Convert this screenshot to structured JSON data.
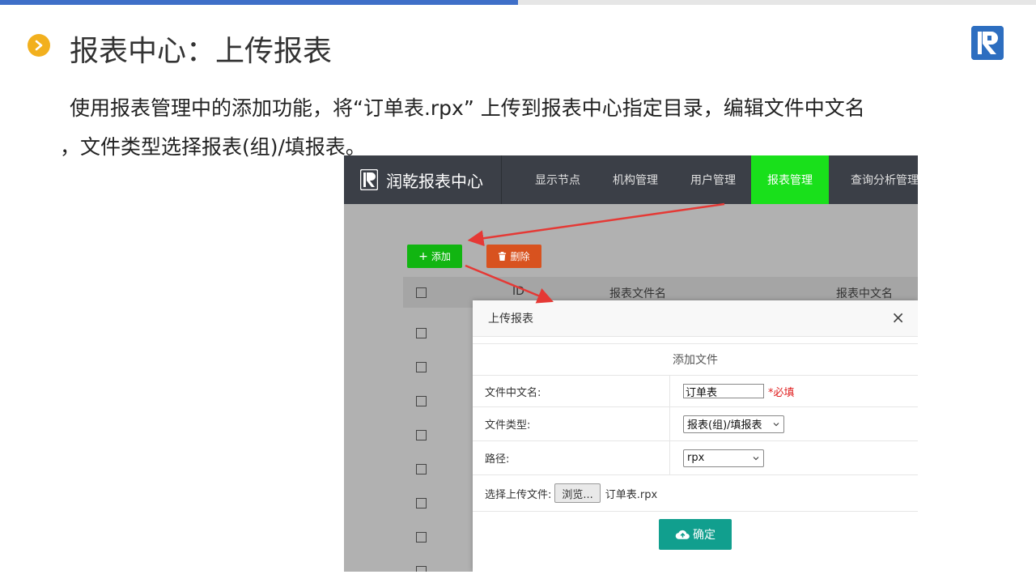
{
  "slide": {
    "title": "报表中心：上传报表",
    "description_line1": "使用报表管理中的添加功能，将“订单表.rpx” 上传到报表中心指定目录，编辑文件中文名",
    "description_line2": "，文件类型选择报表(组)/填报表。"
  },
  "app": {
    "brand": "润乾报表中心",
    "nav": [
      {
        "label": "显示节点",
        "active": false
      },
      {
        "label": "机构管理",
        "active": false
      },
      {
        "label": "用户管理",
        "active": false
      },
      {
        "label": "报表管理",
        "active": true
      },
      {
        "label": "查询分析管理",
        "active": false
      }
    ],
    "toolbar": {
      "add_label": "添加",
      "delete_label": "删除"
    },
    "table": {
      "columns": [
        "ID",
        "报表文件名",
        "报表中文名"
      ],
      "row_count": 9
    }
  },
  "modal": {
    "title": "上传报表",
    "close_symbol": "×",
    "section_header": "添加文件",
    "fields": {
      "chinese_name_label": "文件中文名:",
      "chinese_name_value": "订单表",
      "required_text": "*必填",
      "file_type_label": "文件类型:",
      "file_type_value": "报表(组)/填报表",
      "path_label": "路径:",
      "path_value": "rpx",
      "upload_label": "选择上传文件:",
      "browse_label": "浏览...",
      "selected_file": "订单表.rpx"
    },
    "confirm_label": "确定"
  },
  "colors": {
    "accent_blue": "#3f6fc8",
    "bullet_yellow": "#f2b01e",
    "nav_active_green": "#19e01b",
    "add_green": "#11b511",
    "delete_orange": "#d8521f",
    "confirm_teal": "#119f8e",
    "required_red": "#e02020",
    "arrow_red": "#e53935"
  }
}
